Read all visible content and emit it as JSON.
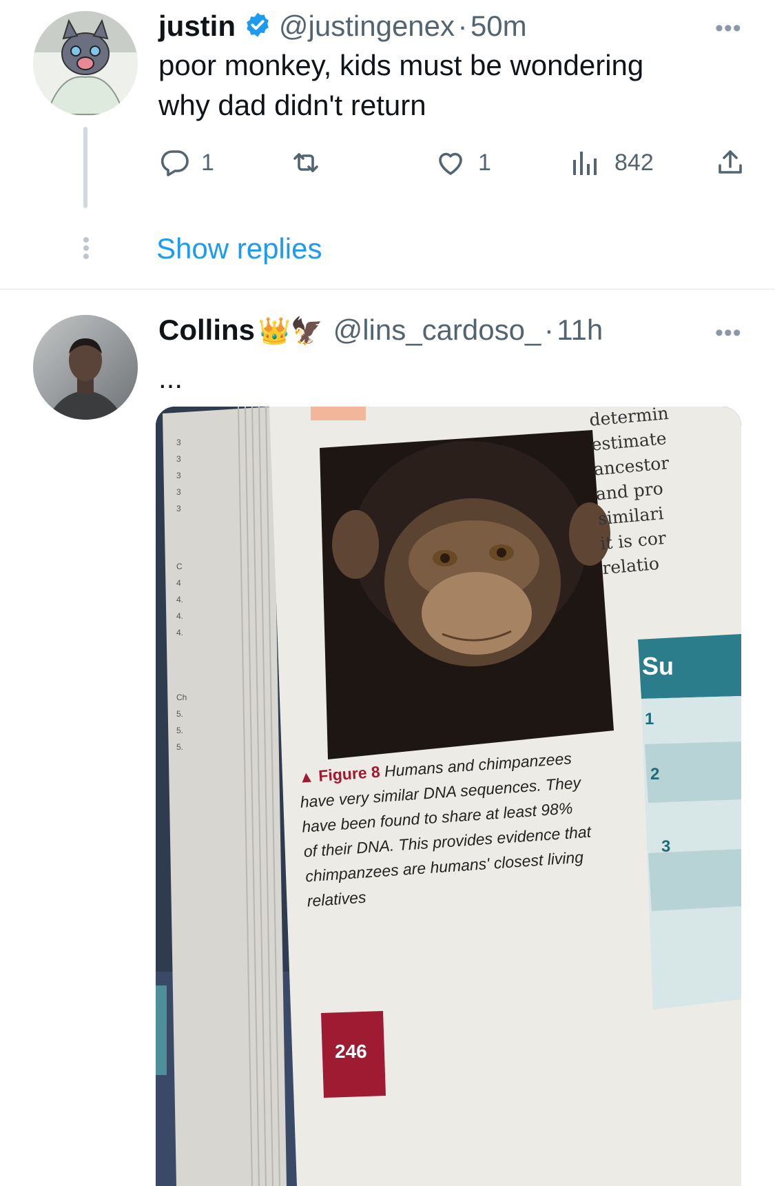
{
  "tweet1": {
    "name": "justin",
    "handle": "@justingenex",
    "separator": "·",
    "time": "50m",
    "text_line1": "poor monkey, kids must be wondering",
    "text_line2": "why dad didn't return",
    "replies": "1",
    "likes": "1",
    "views": "842",
    "show_replies": "Show replies"
  },
  "tweet2": {
    "name": "Collins",
    "emoji": "👑🦅",
    "handle": "@lins_cardoso_",
    "separator": "·",
    "time": "11h",
    "text": "...",
    "media": {
      "book_right_column": [
        "determin",
        "estimate",
        "ancestor",
        "and pro",
        "similari",
        "it is cor",
        "relatio"
      ],
      "table_header": "Su",
      "table_rows": [
        "1",
        "2",
        "3"
      ],
      "figure_label": "Figure 8",
      "caption_lines": [
        "Humans and chimpanzees",
        "have very similar DNA sequences. They",
        "have been found to share at least 98%",
        "of their DNA. This provides evidence that",
        "chimpanzees are humans' closest living",
        "relatives"
      ],
      "page_number": "246",
      "margin_numbers": [
        "3",
        "3",
        "3",
        "3",
        "3",
        "C",
        "4",
        "4.",
        "4.",
        "4.",
        "Ch",
        "5.",
        "5.",
        "5."
      ]
    }
  },
  "colors": {
    "accent": "#1d9bf0",
    "text_secondary": "#536471",
    "page_tab": "#9e1b32"
  },
  "icons": [
    "verified-badge-icon",
    "reply-icon",
    "retweet-icon",
    "like-icon",
    "views-icon",
    "share-icon",
    "more-icon"
  ]
}
